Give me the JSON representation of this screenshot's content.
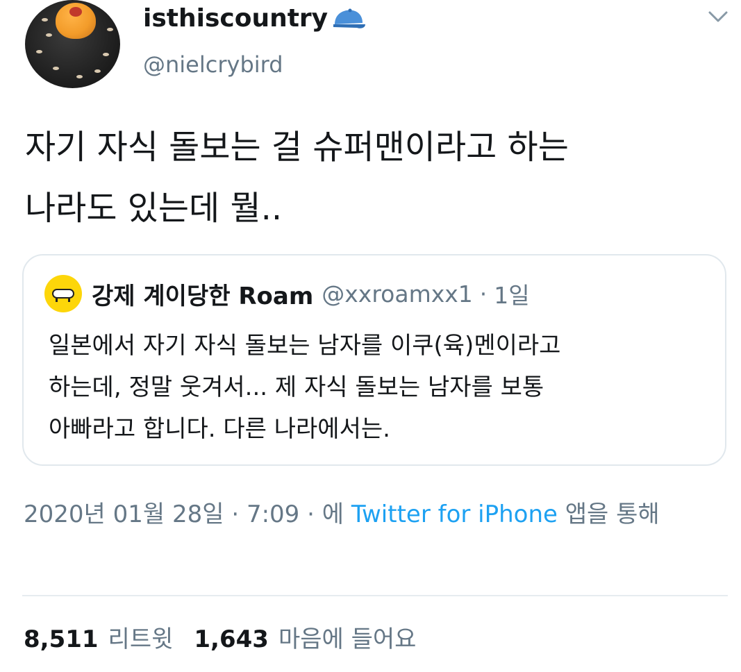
{
  "user": {
    "display_name": "isthiscountry",
    "handle": "@nielcrybird",
    "badge_icon": "cap-icon",
    "avatar_icon": "dessert-avatar"
  },
  "menu_icon": "chevron-down-icon",
  "tweet": {
    "text": "자기 자식 돌보는 걸 슈퍼맨이라고 하는\n나라도 있는데 뭘.."
  },
  "quote": {
    "avatar_icon": "sheep-avatar",
    "name": "강제 계이당한 Roam",
    "handle": "@xxroamxx1",
    "separator": "·",
    "time": "1일",
    "text": "일본에서 자기 자식 돌보는 남자를 이쿠(육)멘이라고\n하는데, 정말 웃겨서... 제 자식 돌보는 남자를 보통\n아빠라고 합니다. 다른 나라에서는."
  },
  "meta": {
    "date": "2020년 01월 28일",
    "sep1": " · ",
    "time": "7:09",
    "sep2": " · ",
    "via_prefix": "에 ",
    "source": "Twitter for iPhone",
    "via_suffix": " 앱을 통해"
  },
  "stats": {
    "retweets_count": "8,511",
    "retweets_label": "리트윗",
    "likes_count": "1,643",
    "likes_label": "마음에 들어요"
  },
  "colors": {
    "text": "#14171a",
    "secondary": "#657786",
    "link": "#1da1f2",
    "border": "#e1e8ed",
    "badge_blue": "#4a90d9",
    "quote_avatar_bg": "#fdd60a"
  }
}
